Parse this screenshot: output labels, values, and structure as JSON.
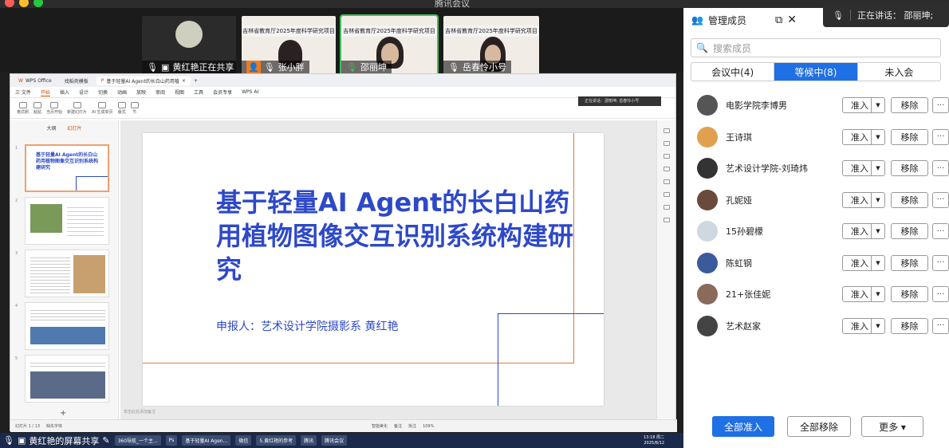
{
  "window": {
    "title": "腾讯会议"
  },
  "video_tiles": [
    {
      "name": "黄红艳正在共享",
      "icon": "screen-share-icon"
    },
    {
      "name": "张小胖",
      "banner": "吉林省教育厅2025年度科学研究项目"
    },
    {
      "name": "邵丽坤",
      "banner": "吉林省教育厅2025年度科学研究项目"
    },
    {
      "name": "岳春怜小号",
      "banner": "吉林省教育厅2025年度科学研究项目"
    }
  ],
  "wps": {
    "tabs": [
      "WPS Office",
      "找稻壳模板",
      "基于轻量AI Agent的长白山药用植"
    ],
    "menu": [
      "三 文件",
      "开始",
      "插入",
      "设计",
      "切换",
      "动画",
      "放映",
      "审阅",
      "视图",
      "工具",
      "会员专享",
      "WPS AI"
    ],
    "menu_selected": "开始",
    "ribbon": [
      "格式刷",
      "粘贴",
      "当页开始",
      "新建幻灯片",
      "AI 生成单页",
      "版式",
      "节"
    ],
    "panel_tabs": [
      "大纲",
      "幻灯片"
    ],
    "thumb1_title": "基于轻量AI Agent的长白山药用植物图像交互识别系统构建研究",
    "slide": {
      "title": "基于轻量AI Agent的长白山药用植物图像交互识别系统构建研究",
      "subtitle": "申报人：艺术设计学院摄影系 黄红艳"
    },
    "notes_hint": "单击此处添加备注",
    "status": [
      "幻灯片 1 / 13",
      "缺失字体",
      "智能美化",
      "备注",
      "批注",
      "109%"
    ],
    "speaking_mini": "正在讲话：邵丽坤; 岳春怜小号"
  },
  "taskbar": {
    "share_label": "黄红艳的屏幕共享",
    "items": [
      "360导航_一个主...",
      "Ps",
      "基于轻量AI Agen...",
      "微信",
      "5.黄红艳的参考",
      "腾讯",
      "腾讯会议"
    ],
    "time": "13:18 周二",
    "date": "2025/8/12"
  },
  "side": {
    "header": "管理成员",
    "search_placeholder": "搜索成员",
    "segments": [
      "会议中(4)",
      "等候中(8)",
      "未入会"
    ],
    "segment_selected": 1,
    "admit_label": "准入",
    "remove_label": "移除",
    "members": [
      "电影学院李博男",
      "王诗琪",
      "艺术设计学院-刘琦炜",
      "孔妮娅",
      "15孙碧檬",
      "陈虹钢",
      "21+张佳妮",
      "艺术赵家"
    ],
    "footer": {
      "admit_all": "全部准入",
      "remove_all": "全部移除",
      "more": "更多 ▾"
    }
  },
  "speaking": {
    "text": "正在讲话：  邵丽坤;"
  },
  "colors": {
    "accent": "#1f6fe5",
    "slide_blue": "#2d49c8",
    "wps_orange": "#d04a02",
    "active_green": "#3fbf5b"
  }
}
